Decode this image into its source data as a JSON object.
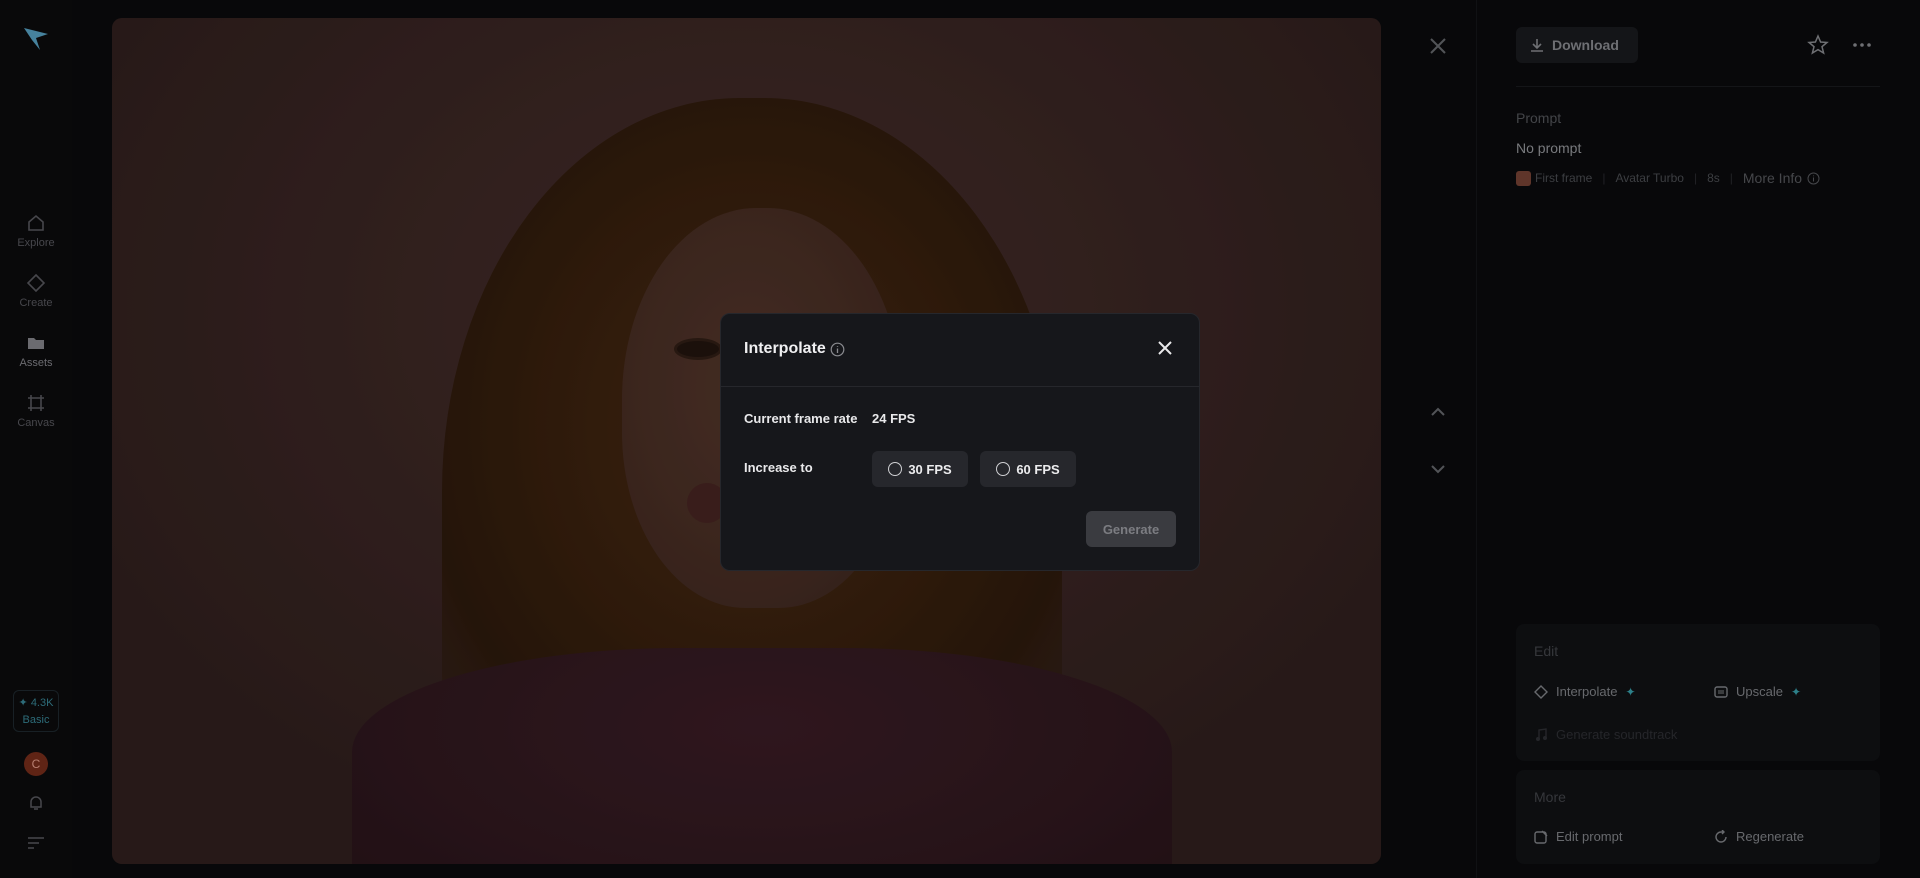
{
  "nav": {
    "items": [
      {
        "label": "Explore",
        "icon": "home-icon"
      },
      {
        "label": "Create",
        "icon": "diamond-icon"
      },
      {
        "label": "Assets",
        "icon": "folder-icon"
      },
      {
        "label": "Canvas",
        "icon": "canvas-icon"
      }
    ],
    "credits": {
      "amount": "4.3K",
      "plan": "Basic"
    },
    "avatar_initial": "C"
  },
  "toolbar": {
    "download_label": "Download"
  },
  "details": {
    "prompt_heading": "Prompt",
    "prompt_value": "No prompt",
    "meta": {
      "first_frame": "First frame",
      "model": "Avatar Turbo",
      "duration": "8s",
      "more_info": "More Info"
    }
  },
  "edit_card": {
    "heading": "Edit",
    "interpolate_label": "Interpolate",
    "upscale_label": "Upscale",
    "soundtrack_label": "Generate soundtrack"
  },
  "more_card": {
    "heading": "More",
    "edit_prompt_label": "Edit prompt",
    "regenerate_label": "Regenerate"
  },
  "modal": {
    "title": "Interpolate",
    "current_label": "Current frame rate",
    "current_value": "24 FPS",
    "increase_label": "Increase to",
    "options": [
      "30 FPS",
      "60 FPS"
    ],
    "generate_label": "Generate"
  },
  "colors": {
    "accent": "#3aa4b0",
    "avatar": "#7a2f1c"
  }
}
